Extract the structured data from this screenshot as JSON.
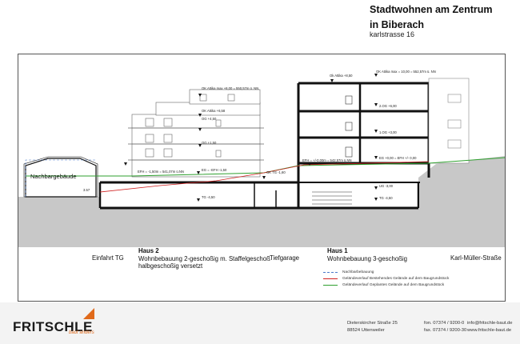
{
  "header": {
    "title_line1": "Stadtwohnen am Zentrum",
    "title_line2": "in Biberach",
    "address": "karlstrasse 16"
  },
  "drawing": {
    "neighbor_label": "Nachbargebäude",
    "neighbor_level": "3.57",
    "level_labels": {
      "haus2_ok_attika_max": "OK Attika max +8,00 = 550,57m ü. NN",
      "haus2_ok_attika": "OK Attika +6,58",
      "haus2_og2": "OG +4,50",
      "haus2_og1": "OG +1,50",
      "haus2_efh": "EFH = -1,50m = 541,07m ü.NN",
      "haus2_eg": "EG = -EFH -1,50",
      "haus2_tg": "TG -4,50",
      "tg_top": "OK TG -1,60",
      "haus1_ok_attika": "Ok Attika +8,50",
      "haus1_ok_attika_max": "OK Attika max = 10,00 = 552,57m ü. NN",
      "haus1_2og": "2.OG +6,00",
      "haus1_1og": "1.OG +3,00",
      "haus1_eg": "EG +0,00 = EFH +/- 0,00",
      "haus1_efh": "EFH = +/-0,00m = 542,57m ü.NN",
      "haus1_ug": "UG -3,00",
      "haus1_tg": "TG -4,50"
    }
  },
  "captions": {
    "einfahrt": "Einfahrt TG",
    "haus2_title": "Haus 2",
    "haus2_line1": "Wohnbebauung 2-geschoßig m. Staffelgeschoß",
    "haus2_line2": "halbgeschoßig versetzt",
    "tiefgarage": "Tiefgarage",
    "haus1_title": "Haus 1",
    "haus1_line1": "Wohnbebauung 3-geschoßig",
    "street": "Karl-Müller-Straße"
  },
  "legend": [
    {
      "label": "Nachbarbebauung",
      "color": "#4a7ac8",
      "style": "dashed"
    },
    {
      "label": "Geländeverlauf Bestehendes Gelände auf dem Baugrundstück",
      "color": "#d02020",
      "style": "solid"
    },
    {
      "label": "Geländeverlauf Geplantes Gelände auf dem Baugrundstück",
      "color": "#2fa02f",
      "style": "solid"
    }
  ],
  "footer": {
    "logo_text": "FRITSCHLE",
    "logo_tagline": "baut anders",
    "address_street": "Dieterskircher Straße 25",
    "address_city": "88524 Uttenweiler",
    "phone": "fon. 07374 / 9200-0",
    "fax": "fax. 07374 / 9200-30",
    "email": "info@fritschle-baut.de",
    "web": "www.fritschle-baut.de"
  },
  "colors": {
    "ground": "#c8c8c8",
    "wall": "#111111",
    "accent": "#e06a1b"
  }
}
